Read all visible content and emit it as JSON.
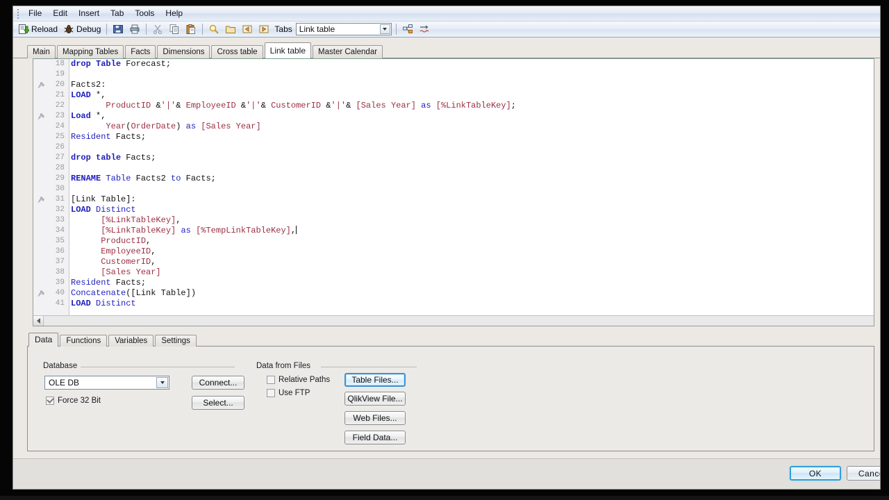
{
  "menu": {
    "items": [
      {
        "label": "File"
      },
      {
        "label": "Edit"
      },
      {
        "label": "Insert"
      },
      {
        "label": "Tab"
      },
      {
        "label": "Tools"
      },
      {
        "label": "Help"
      }
    ]
  },
  "toolbar": {
    "reload_label": "Reload",
    "debug_label": "Debug",
    "tabs_label": "Tabs",
    "tabs_value": "Link table",
    "icons": [
      "reload-icon",
      "debug-icon",
      "save-icon",
      "print-icon",
      "cut-icon",
      "copy-icon",
      "paste-icon",
      "find-icon",
      "open-folder-icon",
      "previous-tab-icon",
      "next-tab-icon",
      "promote-tab-icon",
      "indent-icon"
    ]
  },
  "script_tabs": [
    {
      "label": "Main",
      "active": false
    },
    {
      "label": "Mapping Tables",
      "active": false
    },
    {
      "label": "Facts",
      "active": false
    },
    {
      "label": "Dimensions",
      "active": false
    },
    {
      "label": "Cross table",
      "active": false
    },
    {
      "label": "Link table",
      "active": true
    },
    {
      "label": "Master Calendar",
      "active": false
    }
  ],
  "editor": {
    "first_line": 18,
    "lines": [
      {
        "n": 18,
        "bookmark": false,
        "tokens": [
          {
            "t": "drop",
            "c": "kw"
          },
          {
            "t": " ",
            "c": "plain"
          },
          {
            "t": "Table",
            "c": "kw"
          },
          {
            "t": " Forecast;",
            "c": "plain"
          }
        ]
      },
      {
        "n": 19,
        "bookmark": false,
        "tokens": []
      },
      {
        "n": 20,
        "bookmark": true,
        "tokens": [
          {
            "t": "Facts2:",
            "c": "plain"
          }
        ]
      },
      {
        "n": 21,
        "bookmark": false,
        "tokens": [
          {
            "t": "LOAD",
            "c": "kw"
          },
          {
            "t": " *,",
            "c": "plain"
          }
        ]
      },
      {
        "n": 22,
        "bookmark": false,
        "tokens": [
          {
            "t": "       ",
            "c": "plain"
          },
          {
            "t": "ProductID",
            "c": "fld"
          },
          {
            "t": " &",
            "c": "plain"
          },
          {
            "t": "'|'",
            "c": "str"
          },
          {
            "t": "& ",
            "c": "plain"
          },
          {
            "t": "EmployeeID",
            "c": "fld"
          },
          {
            "t": " &",
            "c": "plain"
          },
          {
            "t": "'|'",
            "c": "str"
          },
          {
            "t": "& ",
            "c": "plain"
          },
          {
            "t": "CustomerID",
            "c": "fld"
          },
          {
            "t": " &",
            "c": "plain"
          },
          {
            "t": "'|'",
            "c": "str"
          },
          {
            "t": "& ",
            "c": "plain"
          },
          {
            "t": "[Sales Year]",
            "c": "fld"
          },
          {
            "t": " ",
            "c": "plain"
          },
          {
            "t": "as",
            "c": "kw2"
          },
          {
            "t": " ",
            "c": "plain"
          },
          {
            "t": "[%LinkTableKey]",
            "c": "fld"
          },
          {
            "t": ";",
            "c": "plain"
          }
        ]
      },
      {
        "n": 23,
        "bookmark": true,
        "tokens": [
          {
            "t": "Load",
            "c": "kw"
          },
          {
            "t": " *,",
            "c": "plain"
          }
        ]
      },
      {
        "n": 24,
        "bookmark": false,
        "tokens": [
          {
            "t": "       ",
            "c": "plain"
          },
          {
            "t": "Year",
            "c": "fld"
          },
          {
            "t": "(",
            "c": "plain"
          },
          {
            "t": "OrderDate",
            "c": "fld"
          },
          {
            "t": ") ",
            "c": "plain"
          },
          {
            "t": "as",
            "c": "kw2"
          },
          {
            "t": " ",
            "c": "plain"
          },
          {
            "t": "[Sales Year]",
            "c": "fld"
          }
        ]
      },
      {
        "n": 25,
        "bookmark": false,
        "tokens": [
          {
            "t": "Resident",
            "c": "kw2"
          },
          {
            "t": " Facts;",
            "c": "plain"
          }
        ]
      },
      {
        "n": 26,
        "bookmark": false,
        "tokens": []
      },
      {
        "n": 27,
        "bookmark": false,
        "tokens": [
          {
            "t": "drop",
            "c": "kw"
          },
          {
            "t": " ",
            "c": "plain"
          },
          {
            "t": "table",
            "c": "kw"
          },
          {
            "t": " Facts;",
            "c": "plain"
          }
        ]
      },
      {
        "n": 28,
        "bookmark": false,
        "tokens": []
      },
      {
        "n": 29,
        "bookmark": false,
        "tokens": [
          {
            "t": "RENAME",
            "c": "kw"
          },
          {
            "t": " ",
            "c": "plain"
          },
          {
            "t": "Table",
            "c": "kw2"
          },
          {
            "t": " Facts2 ",
            "c": "plain"
          },
          {
            "t": "to",
            "c": "kw2"
          },
          {
            "t": " Facts;",
            "c": "plain"
          }
        ]
      },
      {
        "n": 30,
        "bookmark": false,
        "tokens": []
      },
      {
        "n": 31,
        "bookmark": true,
        "tokens": [
          {
            "t": "[Link Table]:",
            "c": "plain"
          }
        ]
      },
      {
        "n": 32,
        "bookmark": false,
        "tokens": [
          {
            "t": "LOAD",
            "c": "kw"
          },
          {
            "t": " ",
            "c": "plain"
          },
          {
            "t": "Distinct",
            "c": "kw2"
          }
        ]
      },
      {
        "n": 33,
        "bookmark": false,
        "tokens": [
          {
            "t": "      ",
            "c": "plain"
          },
          {
            "t": "[%LinkTableKey]",
            "c": "fld"
          },
          {
            "t": ",",
            "c": "plain"
          }
        ]
      },
      {
        "n": 34,
        "bookmark": false,
        "tokens": [
          {
            "t": "      ",
            "c": "plain"
          },
          {
            "t": "[%LinkTableKey]",
            "c": "fld"
          },
          {
            "t": " ",
            "c": "plain"
          },
          {
            "t": "as",
            "c": "kw2"
          },
          {
            "t": " ",
            "c": "plain"
          },
          {
            "t": "[%TempLinkTableKey]",
            "c": "fld"
          },
          {
            "t": ",",
            "c": "plain"
          }
        ],
        "caret": true
      },
      {
        "n": 35,
        "bookmark": false,
        "tokens": [
          {
            "t": "      ",
            "c": "plain"
          },
          {
            "t": "ProductID",
            "c": "fld"
          },
          {
            "t": ",",
            "c": "plain"
          }
        ]
      },
      {
        "n": 36,
        "bookmark": false,
        "tokens": [
          {
            "t": "      ",
            "c": "plain"
          },
          {
            "t": "EmployeeID",
            "c": "fld"
          },
          {
            "t": ",",
            "c": "plain"
          }
        ]
      },
      {
        "n": 37,
        "bookmark": false,
        "tokens": [
          {
            "t": "      ",
            "c": "plain"
          },
          {
            "t": "CustomerID",
            "c": "fld"
          },
          {
            "t": ",",
            "c": "plain"
          }
        ]
      },
      {
        "n": 38,
        "bookmark": false,
        "tokens": [
          {
            "t": "      ",
            "c": "plain"
          },
          {
            "t": "[Sales Year]",
            "c": "fld"
          }
        ]
      },
      {
        "n": 39,
        "bookmark": false,
        "tokens": [
          {
            "t": "Resident",
            "c": "kw2"
          },
          {
            "t": " Facts;",
            "c": "plain"
          }
        ]
      },
      {
        "n": 40,
        "bookmark": true,
        "tokens": [
          {
            "t": "Concatenate",
            "c": "kw2"
          },
          {
            "t": "([Link Table])",
            "c": "plain"
          }
        ]
      },
      {
        "n": 41,
        "bookmark": false,
        "tokens": [
          {
            "t": "LOAD",
            "c": "kw"
          },
          {
            "t": " ",
            "c": "plain"
          },
          {
            "t": "Distinct",
            "c": "kw2"
          }
        ]
      }
    ]
  },
  "lower_tabs": [
    {
      "label": "Data",
      "active": true
    },
    {
      "label": "Functions",
      "active": false
    },
    {
      "label": "Variables",
      "active": false
    },
    {
      "label": "Settings",
      "active": false
    }
  ],
  "database_group": {
    "title": "Database",
    "provider_value": "OLE DB",
    "connect_label": "Connect...",
    "select_label": "Select...",
    "force32_label": "Force 32 Bit",
    "force32_checked": true
  },
  "files_group": {
    "title": "Data from Files",
    "relative_paths_label": "Relative Paths",
    "relative_paths_checked": false,
    "use_ftp_label": "Use FTP",
    "use_ftp_checked": false,
    "buttons": [
      {
        "label": "Table Files...",
        "focused": true
      },
      {
        "label": "QlikView File...",
        "focused": false
      },
      {
        "label": "Web Files...",
        "focused": false
      },
      {
        "label": "Field Data...",
        "focused": false
      }
    ]
  },
  "footer": {
    "ok_label": "OK",
    "cancel_label": "Cancel"
  },
  "colors": {
    "keyword": "#1d1dbe",
    "field": "#9c2f42",
    "accent": "#2f9fdd",
    "panel": "#eceae7"
  }
}
